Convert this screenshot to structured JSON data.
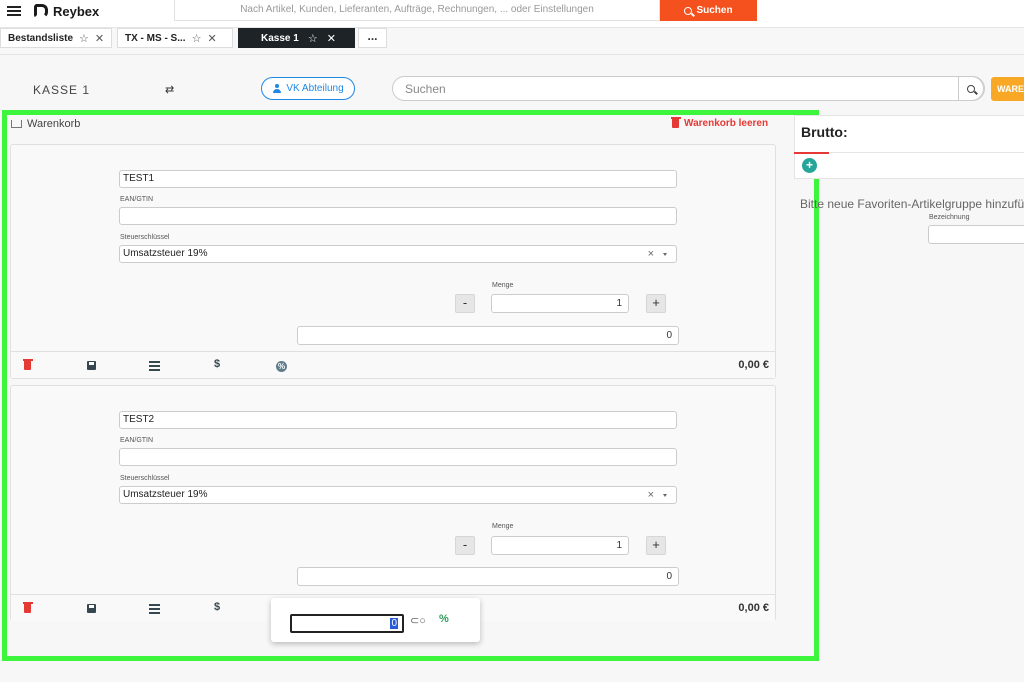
{
  "header": {
    "app_name": "Reybex",
    "search_placeholder": "Nach Artikel, Kunden, Lieferanten, Aufträge, Rechnungen, ... oder Einstellungen",
    "search_button": "Suchen"
  },
  "tabs": [
    {
      "label": "Bestandsliste",
      "active": false
    },
    {
      "label": "TX - MS - S...",
      "active": false
    },
    {
      "label": "Kasse 1",
      "active": true
    }
  ],
  "tabs_more": "...",
  "pos": {
    "title": "KASSE 1",
    "vk_button": "VK Abteilung",
    "search_placeholder": "Suchen",
    "ware_button": "WARE"
  },
  "cart": {
    "title": "Warenkorb",
    "clear_label": "Warenkorb leeren",
    "items": [
      {
        "name": "TEST1",
        "ean_label": "EAN/GTIN",
        "ean": "",
        "tax_label": "Steuerschlüssel",
        "tax": "Umsatzsteuer 19%",
        "qty_label": "Menge",
        "qty": "1",
        "price": "0",
        "total": "0,00 €"
      },
      {
        "name": "TEST2",
        "ean_label": "EAN/GTIN",
        "ean": "",
        "tax_label": "Steuerschlüssel",
        "tax": "Umsatzsteuer 19%",
        "qty_label": "Menge",
        "qty": "1",
        "price": "0",
        "total": "0,00 €"
      }
    ]
  },
  "discount_popover": {
    "value": "0",
    "percent_symbol": "%"
  },
  "right_panel": {
    "brutto_label": "Brutto:",
    "favorites_hint": "Bitte neue Favoriten-Artikelgruppe hinzufügen",
    "bezeichnung_label": "Bezeichnung"
  },
  "colors": {
    "accent_orange": "#f4511e",
    "primary_blue": "#1e88e5",
    "danger_red": "#e53935",
    "highlight_green": "#3cf53c",
    "ware_yellow": "#f9a825"
  }
}
